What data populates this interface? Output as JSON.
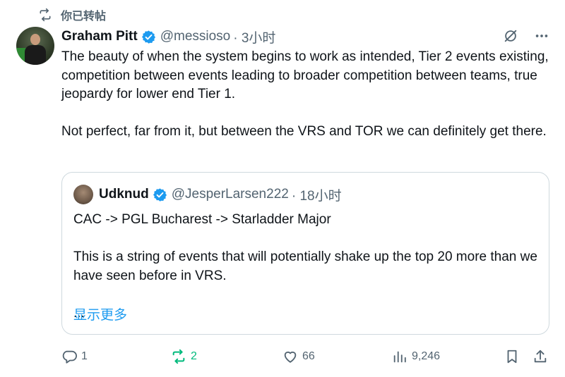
{
  "repost_notice": {
    "label": "你已转帖",
    "icon": "repost-icon"
  },
  "author": {
    "name": "Graham Pitt",
    "handle": "@messioso",
    "time": "· 3小时",
    "verified": true
  },
  "tweet": {
    "paragraphs": [
      "The beauty of when the system begins to work as intended,  Tier 2 events existing, competition between events leading to broader competition between teams, true jeopardy for lower end Tier 1.",
      "Not perfect, far from it, but between the VRS and TOR we can definitely get there."
    ]
  },
  "quoted": {
    "name": "Udknud",
    "handle": "@JesperLarsen222",
    "time": "· 18小时",
    "verified": true,
    "paragraphs": [
      "CAC -> PGL Bucharest -> Starladder Major",
      "This is a string of events that will potentially shake up the top 20 more than we have seen before in VRS."
    ],
    "ellipsis": "...",
    "show_more": "显示更多"
  },
  "actions": {
    "replies": "1",
    "reposts": "2",
    "likes": "66",
    "views": "9,246"
  },
  "colors": {
    "accent": "#1d9bf0",
    "repost_active": "#00ba7c",
    "muted": "#536471",
    "border": "#cfd9de"
  }
}
